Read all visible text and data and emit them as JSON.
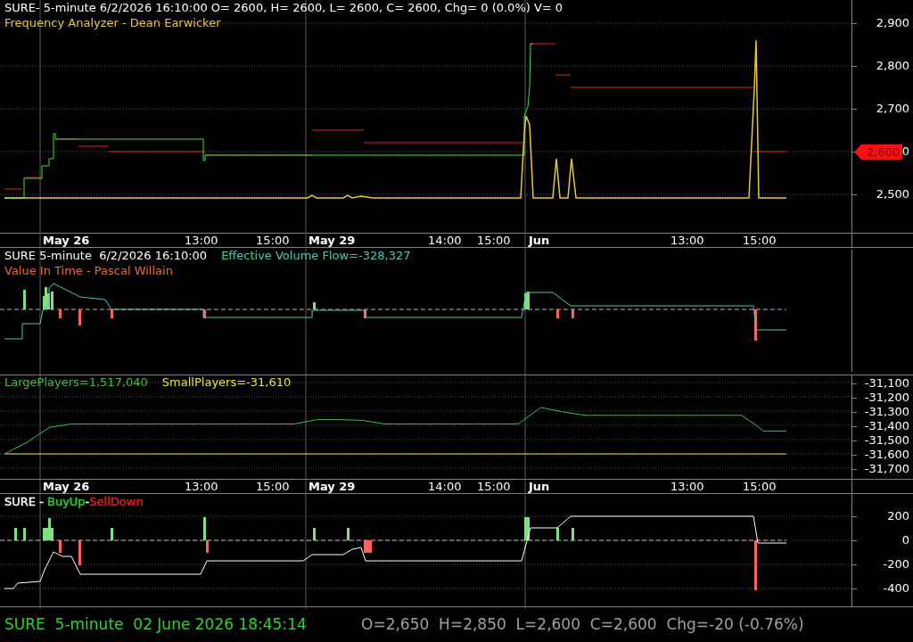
{
  "panes": [
    {
      "kind": "price",
      "legend": [
        [
          {
            "text": "SURE- 5-minute 6/2/2026 16:10:00 O= 2600, H= 2600, L= 2600, C= 2600, Chg= 0 (0.0%) V= 0",
            "color": "#ffffff"
          }
        ],
        [
          {
            "text": "Frequency Analyzer - Dean Earwicker",
            "color": "#e8c832"
          }
        ]
      ],
      "y_ticks": [
        "2,900",
        "2,800",
        "2,700",
        "0",
        "2,500"
      ],
      "price_tag": "2,600"
    },
    {
      "kind": "flow",
      "legend": [
        [
          {
            "text": "SURE 5-minute  6/2/2026 16:10:00",
            "color": "#ffffff"
          },
          {
            "text": "Effective Volume Flow=-328,327",
            "color": "#4fc7b8"
          }
        ],
        [
          {
            "text": "Value In Time - Pascal Willain",
            "color": "#e86a2a"
          }
        ]
      ]
    },
    {
      "kind": "players",
      "legend": [
        [
          {
            "text": "LargePlayers=1,517,040",
            "color": "#3fbf3f"
          },
          {
            "text": "SmallPlayers=-31,610",
            "color": "#e8e832"
          }
        ]
      ],
      "chart_data": {
        "type": "line",
        "ylim": [
          -31781,
          -31044
        ],
        "grid": true,
        "yticks": [
          {
            "value": -31100,
            "label": "-31,100"
          },
          {
            "value": -31200,
            "label": "-31,200"
          },
          {
            "value": -31300,
            "label": "-31,300"
          },
          {
            "value": -31400,
            "label": "-31,400"
          },
          {
            "value": -31500,
            "label": "-31,500"
          },
          {
            "value": -31600,
            "label": "-31,600"
          },
          {
            "value": -31700,
            "label": "-31,700"
          }
        ],
        "series": [
          {
            "color": "#3fbf3f",
            "values": [
              -31600,
              -31520,
              -31415,
              -31390,
              -31390,
              -31390,
              -31390,
              -31390,
              -31390,
              -31390,
              -31390,
              -31390,
              -31390,
              -31390,
              -31360,
              -31360,
              -31365,
              -31390,
              -31390,
              -31390,
              -31390,
              -31390,
              -31390,
              -31390,
              -31275,
              -31306,
              -31330,
              -31330,
              -31330,
              -31330,
              -31330,
              -31330,
              -31330,
              -31330,
              -31440,
              -31440
            ]
          },
          {
            "color": "#e8e832",
            "values": [
              -31600,
              -31600,
              -31600,
              -31600,
              -31600,
              -31600,
              -31600,
              -31600,
              -31600,
              -31600,
              -31600,
              -31600,
              -31600,
              -31600,
              -31600,
              -31600,
              -31600,
              -31600,
              -31600,
              -31600,
              -31600,
              -31600,
              -31600,
              -31600,
              -31600,
              -31600,
              -31600,
              -31600,
              -31600,
              -31600,
              -31600,
              -31600,
              -31600,
              -31600,
              -31600,
              -31600
            ]
          }
        ]
      }
    },
    {
      "kind": "buysell",
      "legend": [
        [
          {
            "text": "SURE - ",
            "color": "#ffffff"
          },
          {
            "text": "BuyUp",
            "color": "#2fd02f"
          },
          {
            "text": "-",
            "color": "#ffffff"
          },
          {
            "text": "SellDown",
            "color": "#e02020"
          }
        ]
      ],
      "y_ticks": [
        "200",
        "0",
        "-200",
        "-400"
      ]
    }
  ],
  "date_axes": [
    [
      {
        "text": "May 26",
        "kind": "day"
      },
      {
        "text": "13:00",
        "kind": "time"
      },
      {
        "text": "15:00",
        "kind": "time"
      },
      {
        "text": "May 29",
        "kind": "day"
      },
      {
        "text": "14:00",
        "kind": "time"
      },
      {
        "text": "15:00",
        "kind": "time"
      },
      {
        "text": "Jun",
        "kind": "day"
      },
      {
        "text": "13:00",
        "kind": "time"
      },
      {
        "text": "15:00",
        "kind": "time"
      }
    ],
    [
      {
        "text": "May 26",
        "kind": "day"
      },
      {
        "text": "13:00",
        "kind": "time"
      },
      {
        "text": "15:00",
        "kind": "time"
      },
      {
        "text": "May 29",
        "kind": "day"
      },
      {
        "text": "14:00",
        "kind": "time"
      },
      {
        "text": "15:00",
        "kind": "time"
      },
      {
        "text": "Jun",
        "kind": "day"
      },
      {
        "text": "13:00",
        "kind": "time"
      },
      {
        "text": "15:00",
        "kind": "time"
      }
    ]
  ],
  "status_bar": {
    "symbol_info": "SURE  5-minute  02 June 2026 18:45:14",
    "quote": "O=2,650  H=2,850  L=2,600  C=2,600  Chg=-20 (-0.76%)"
  }
}
